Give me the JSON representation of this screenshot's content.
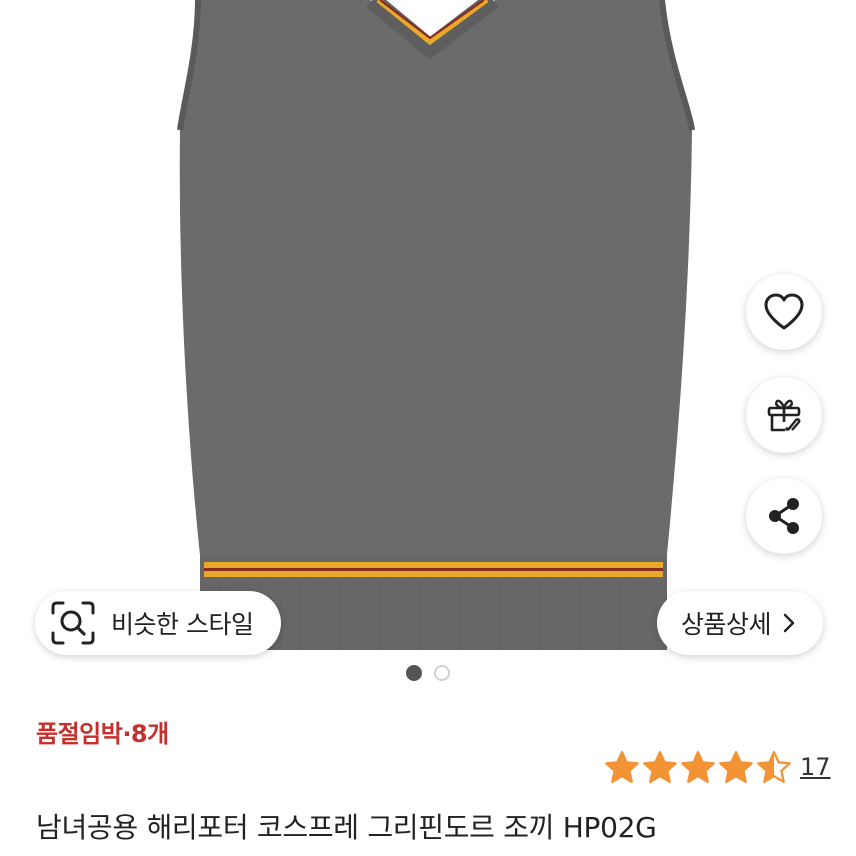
{
  "gallery": {
    "similar_style_label": "비슷한 스타일",
    "product_detail_label": "상품상세",
    "page_dots": {
      "count": 2,
      "active_index": 0
    }
  },
  "actions": {
    "like_icon": "heart-icon",
    "gift_icon": "gift-icon",
    "share_icon": "share-icon"
  },
  "product": {
    "stock_notice": "품절임박·8개",
    "rating": 4.5,
    "review_count": "17",
    "title": "남녀공용 해리포터 코스프레 그리핀도르 조끼 HP02G"
  },
  "colors": {
    "stock_red": "#c4302b",
    "star_orange": "#f29436",
    "vest_gray": "#6e6e6e",
    "stripe_gold": "#e8a92a",
    "stripe_maroon": "#8a2a22"
  }
}
